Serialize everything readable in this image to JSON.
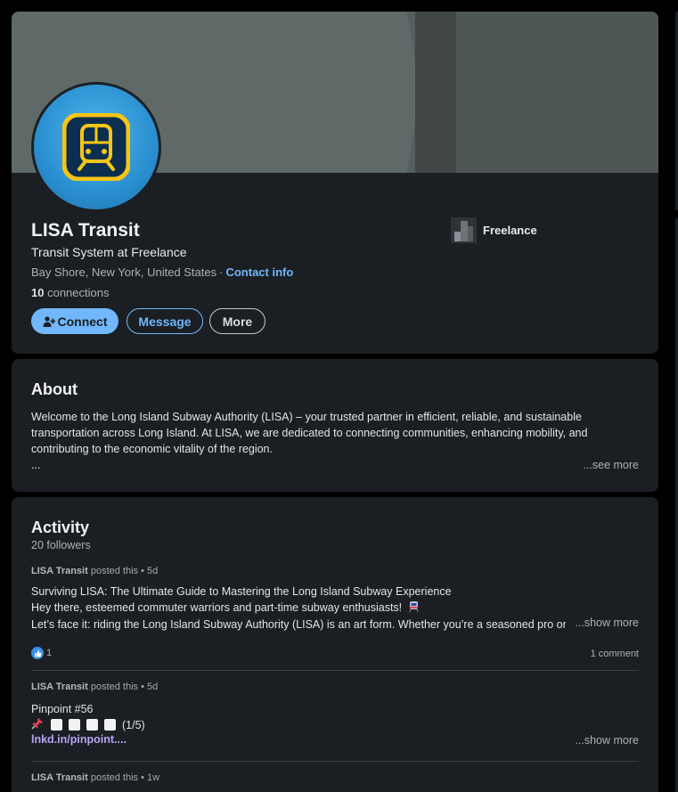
{
  "profile": {
    "name": "LISA Transit",
    "headline": "Transit System at Freelance",
    "location": "Bay Shore, New York, United States",
    "separator": "·",
    "contact_info": "Contact info",
    "connections_count": "10",
    "connections_label": "connections",
    "company": "Freelance",
    "buttons": {
      "connect": "Connect",
      "message": "Message",
      "more": "More"
    }
  },
  "about": {
    "title": "About",
    "line1": "Welcome to the Long Island Subway Authority (LISA) – your trusted partner in efficient, reliable, and sustainable",
    "line2": "transportation across Long Island. At LISA, we are dedicated to connecting communities, enhancing mobility, and",
    "line3": "contributing to the economic vitality of the region.",
    "ellipsis": "...",
    "see_more": "...see more"
  },
  "activity": {
    "title": "Activity",
    "followers": "20 followers",
    "posts": [
      {
        "author": "LISA Transit",
        "meta": "posted this • 5d",
        "line1": "Surviving LISA: The Ultimate Guide to Mastering the Long Island Subway Experience",
        "line2": "Hey there, esteemed commuter warriors and part-time subway enthusiasts!",
        "line3": "Let’s face it: riding the Long Island Subway Authority (LISA) is an art form. Whether you’re a seasoned pro or",
        "show_more": "...show more",
        "reactions": "1",
        "comments": "1 comment"
      },
      {
        "author": "LISA Transit",
        "meta": "posted this • 5d",
        "line1": "Pinpoint #56",
        "score": "(1/5)",
        "link": "lnkd.in/pinpoint....",
        "show_more": "...show more"
      },
      {
        "author": "LISA Transit",
        "meta": "posted this • 1w"
      }
    ]
  },
  "colors": {
    "accent": "#71b7fb",
    "card_bg": "#1b1f23",
    "link_purple": "#b7a3f5",
    "avatar_blue": "#2a8fd0",
    "logo_yellow": "#f5c518"
  },
  "icons": [
    "train-icon",
    "add-person-icon",
    "company-logo-icon",
    "like-icon",
    "metro-emoji-icon",
    "pin-icon"
  ]
}
